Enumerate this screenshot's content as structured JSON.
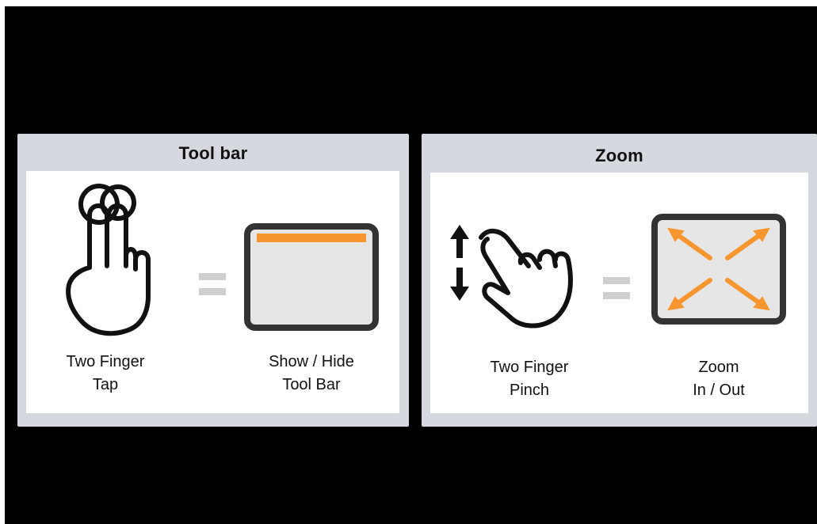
{
  "panels": [
    {
      "title": "Tool bar",
      "gesture": {
        "icon": "two-finger-tap-icon",
        "caption_line1": "Two Finger",
        "caption_line2": "Tap"
      },
      "result": {
        "icon": "toolbar-screen-icon",
        "caption_line1": "Show / Hide",
        "caption_line2": "Tool Bar"
      }
    },
    {
      "title": "Zoom",
      "gesture": {
        "icon": "two-finger-pinch-icon",
        "caption_line1": "Two Finger",
        "caption_line2": "Pinch"
      },
      "result": {
        "icon": "zoom-screen-icon",
        "caption_line1": "Zoom",
        "caption_line2": "In / Out"
      }
    }
  ],
  "colors": {
    "accent": "#f7962e",
    "panel_frame": "#d5d8de",
    "screen_frame": "#333333",
    "screen_fill": "#e6e6e6",
    "equals_sign": "#cfcfcf",
    "background": "#000000"
  }
}
